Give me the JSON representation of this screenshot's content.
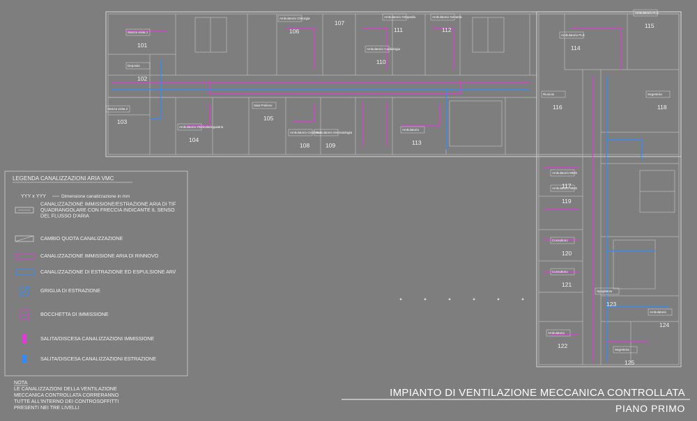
{
  "title": {
    "main": "IMPIANTO DI VENTILAZIONE MECCANICA CONTROLLATA",
    "sub": "PIANO PRIMO"
  },
  "legend": {
    "title": "LEGENDA CANALIZZAZIONI ARIA VMC",
    "dim_sample": "YYY x YYY",
    "dim_desc": "Dimensione canalizzazione in mm",
    "items": [
      {
        "icon": "quadrangular-duct-icon",
        "lines": [
          "CANALIZZAZIONE IMMISSIONE/ESTRAZIONE ARIA DI TIF",
          "QUADRANGOLARE CON FRECCIA INDICANTE IL SENSO",
          "DEL FLUSSO D'ARIA"
        ]
      },
      {
        "icon": "level-change-icon",
        "lines": [
          "CAMBIO QUOTA CANALIZZAZIONE"
        ]
      },
      {
        "icon": "supply-duct-icon",
        "lines": [
          "CANALIZZAZIONE IMMISSIONE ARIA DI RINNOVO"
        ]
      },
      {
        "icon": "extract-duct-icon",
        "lines": [
          "CANALIZZAZIONE DI ESTRAZIONE ED ESPULSIONE ARI/"
        ]
      },
      {
        "icon": "extract-grille-icon",
        "lines": [
          "GRIGLIA DI ESTRAZIONE"
        ]
      },
      {
        "icon": "supply-diffuser-icon",
        "lines": [
          "BOCCHETTA DI IMMISSIONE"
        ]
      },
      {
        "icon": "supply-riser-icon",
        "lines": [
          "SALITA/DISCESA CANALIZZAZIONI IMMISSIONE"
        ]
      },
      {
        "icon": "extract-riser-icon",
        "lines": [
          "SALITA/DISCESA CANALIZZAZIONI ESTRAZIONE"
        ]
      }
    ]
  },
  "note": {
    "title": "NOTA",
    "lines": [
      "LE CANALIZZAZIONI DELLA VENTILAZIONE",
      "MECCANICA CONTROLLATA CORRERANNO",
      "TUTTE ALL'INTERNO DEI CONTROSOFFITTI",
      "PRESENTI NEI TRE LIVELLI"
    ]
  },
  "rooms": [
    {
      "num": "101",
      "label": "Stanza visita 1"
    },
    {
      "num": "102",
      "label": "Deposito"
    },
    {
      "num": "103",
      "label": "Stanza visita 2"
    },
    {
      "num": "104",
      "label": "Ambulatorio Otorinolaringoiatria"
    },
    {
      "num": "105",
      "label": "Sala Prelievo"
    },
    {
      "num": "106",
      "label": "Ambulatorio Chirurgia"
    },
    {
      "num": "107",
      "label": ""
    },
    {
      "num": "108",
      "label": "Ambulatorio Oculistica"
    },
    {
      "num": "109",
      "label": "Ambulatorio Dermatologia"
    },
    {
      "num": "110",
      "label": "Ambulatorio Cardiologia"
    },
    {
      "num": "111",
      "label": "Ambulatorio Ortopedia"
    },
    {
      "num": "112",
      "label": "Ambulatorio Geriatria"
    },
    {
      "num": "113",
      "label": "Ambulatorio"
    },
    {
      "num": "114",
      "label": "Ambulatorio PLS"
    },
    {
      "num": "115",
      "label": "Ambulatorio PLS"
    },
    {
      "num": "116",
      "label": "Riunioni"
    },
    {
      "num": "117",
      "label": "Ambulatorio MMG"
    },
    {
      "num": "118",
      "label": "Segreteria"
    },
    {
      "num": "119",
      "label": "Ambulatorio MMG"
    },
    {
      "num": "120",
      "label": "Consultorio"
    },
    {
      "num": "121",
      "label": "Consultorio"
    },
    {
      "num": "122",
      "label": "Ambulatorio"
    },
    {
      "num": "123",
      "label": "Spogliatoio"
    },
    {
      "num": "124",
      "label": "Ambulatorio"
    },
    {
      "num": "125",
      "label": "Segreteria"
    }
  ],
  "colors": {
    "background": "#7e7e7e",
    "walls": "#c9c9c9",
    "supply": "#e03bd8",
    "extract": "#2f8bff",
    "text": "#ffffff"
  }
}
